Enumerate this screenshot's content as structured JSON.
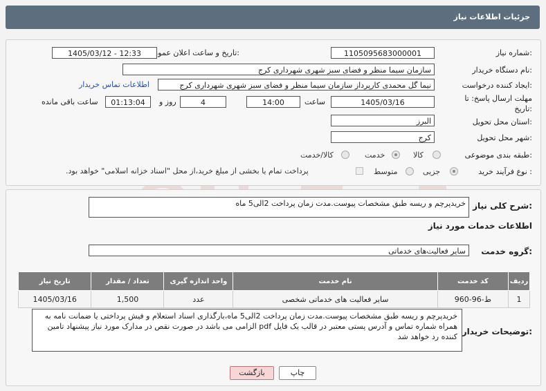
{
  "page_title": "جزئیات اطلاعات نیاز",
  "fields": {
    "need_number_label": "شماره نیاز:",
    "need_number": "1105095683000001",
    "announce_label": "تاریخ و ساعت اعلان عمومی:",
    "announce_value": "1405/03/12 - 12:33",
    "buyer_org_label": "نام دستگاه خریدار:",
    "buyer_org": "سازمان سیما منظر و فضای سبز شهری شهرداری کرج",
    "creator_label": "ایجاد کننده درخواست:",
    "creator": "نیما گل محمدی کارپرداز سازمان سیما منظر و فضای سبز شهری شهرداری کرج",
    "contact_link": "اطلاعات تماس خریدار",
    "deadline_label": "مهلت ارسال پاسخ: تا تاریخ:",
    "deadline_date": "1405/03/16",
    "time_label": "ساعت",
    "deadline_time": "14:00",
    "days_value": "4",
    "days_label": "روز و",
    "remaining_time": "01:13:04",
    "remaining_label": "ساعت باقی مانده",
    "province_label": "استان محل تحویل:",
    "province": "البرز",
    "city_label": "شهر محل تحویل:",
    "city": "کرج",
    "category_label": "طبقه بندی موضوعی:",
    "category_options": [
      "کالا",
      "خدمت",
      "کالا/خدمت"
    ],
    "category_selected": "خدمت",
    "process_label": "نوع فرآیند خرید :",
    "process_options": [
      "جزیی",
      "متوسط"
    ],
    "process_selected": "جزیی",
    "payment_note": "پرداخت تمام یا بخشی از مبلغ خرید،از محل \"اسناد خزانه اسلامی\" خواهد بود."
  },
  "summary": {
    "label": "شرح کلی نیاز:",
    "value": "خریدپرچم و ریسه طبق مشخصات پیوست.مدت زمان پرداخت 2الی5 ماه"
  },
  "services": {
    "section_title": "اطلاعات خدمات مورد نیاز",
    "group_label": "گروه خدمت:",
    "group_value": "سایر فعالیت‌های خدماتی",
    "headers": [
      "ردیف",
      "کد خدمت",
      "نام خدمت",
      "واحد اندازه گیری",
      "تعداد / مقدار",
      "تاریخ نیاز"
    ],
    "rows": [
      [
        "1",
        "ط-96-960",
        "سایر فعالیت های خدماتی شخصی",
        "عدد",
        "1,500",
        "1405/03/16"
      ]
    ]
  },
  "buyer_notes": {
    "label": "توضیحات خریدار:",
    "value": "خریدپرچم و ریسه طبق مشخصات پیوست.مدت زمان پرداخت 2الی5 ماه،بارگذاری اسناد استعلام و فیش پرداختی یا ضمانت نامه به همراه شماره تماس و آدرس پستی معتبر در قالب یک فایل pdf الزامی می باشد در صورت نقص در مدارک مورد نیاز پیشنهاد تامین کننده رد خواهد شد"
  },
  "buttons": {
    "print": "چاپ",
    "back": "بازگشت"
  },
  "colors": {
    "header_bg": "#5d6f7f",
    "table_header_bg": "#7d7d7d",
    "link": "#1e4fc4",
    "back_button_bg": "#f6d6d6"
  },
  "watermark_icons": [
    "ariatender-logo-icon"
  ]
}
